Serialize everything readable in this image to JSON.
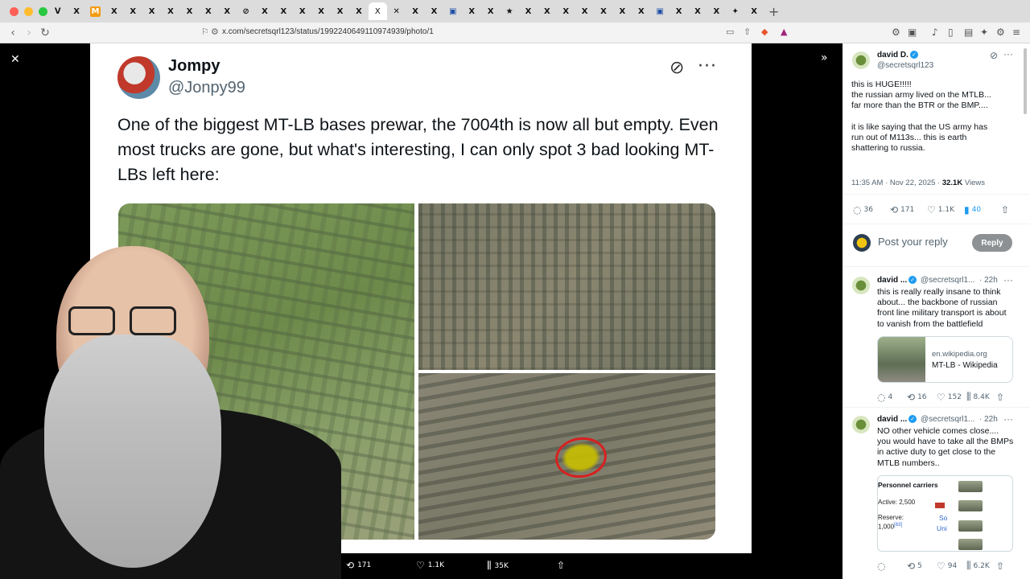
{
  "browser": {
    "url": "x.com/secretsqrl123/status/1992240649110974939/photo/1",
    "colors": {
      "close": "#ff5f57",
      "minimize": "#febc2e",
      "maximize": "#28c840"
    },
    "new_tab": "+"
  },
  "viewer": {
    "close_icon": "✕",
    "expand_icon": "»"
  },
  "quoted": {
    "name": "Jompy",
    "handle": "@Jonpy99",
    "text": "One of the biggest MT-LB bases prewar, the 7004th is now all but empty. Even most trucks are gone, but what's interesting, I can only spot 3 bad looking MT-LBs left here:"
  },
  "bottom_stats": {
    "reposts": "171",
    "likes": "1.1K",
    "views": "35K"
  },
  "post": {
    "name": "david D.",
    "handle": "@secretsqrl123",
    "text_lines": [
      "this is HUGE!!!!!",
      "the russian army lived on the MTLB...",
      "far more than the BTR or the BMP....",
      "",
      "it is like saying that the US army has",
      "run out of M113s... this is earth",
      "shattering to russia."
    ],
    "time": "11:35 AM · Nov 22, 2025 · ",
    "views_count": "32.1K",
    "views_label": " Views",
    "replies": "36",
    "reposts": "171",
    "likes": "1.1K",
    "bookmarks": "40"
  },
  "reply_composer": {
    "placeholder": "Post your reply",
    "button": "Reply"
  },
  "replies": [
    {
      "name": "david ...",
      "handle": "@secretsqrl1...",
      "time": "· 22h",
      "text_lines": [
        "this is really really insane to think",
        "about... the backbone of russian",
        "front line military transport is about",
        "to vanish from the battlefield"
      ],
      "card_domain": "en.wikipedia.org",
      "card_title": "MT-LB - Wikipedia",
      "stats": {
        "replies": "4",
        "reposts": "16",
        "likes": "152",
        "views": "8.4K"
      }
    },
    {
      "name": "david ...",
      "handle": "@secretsqrl1...",
      "time": "· 22h",
      "text_lines": [
        "NO other vehicle comes close....",
        "you would have to take all the BMPs",
        "in active duty to get close to the",
        "MTLB numbers.."
      ],
      "table": {
        "header": "Personnel carriers",
        "active": "Active: 2,500",
        "reserve": "Reserve:",
        "reserve_val": "1,000",
        "ref": "[63]",
        "link1": "So",
        "link2": "Uni"
      },
      "stats": {
        "replies": "",
        "reposts": "5",
        "likes": "94",
        "views": "6.2K"
      }
    }
  ]
}
